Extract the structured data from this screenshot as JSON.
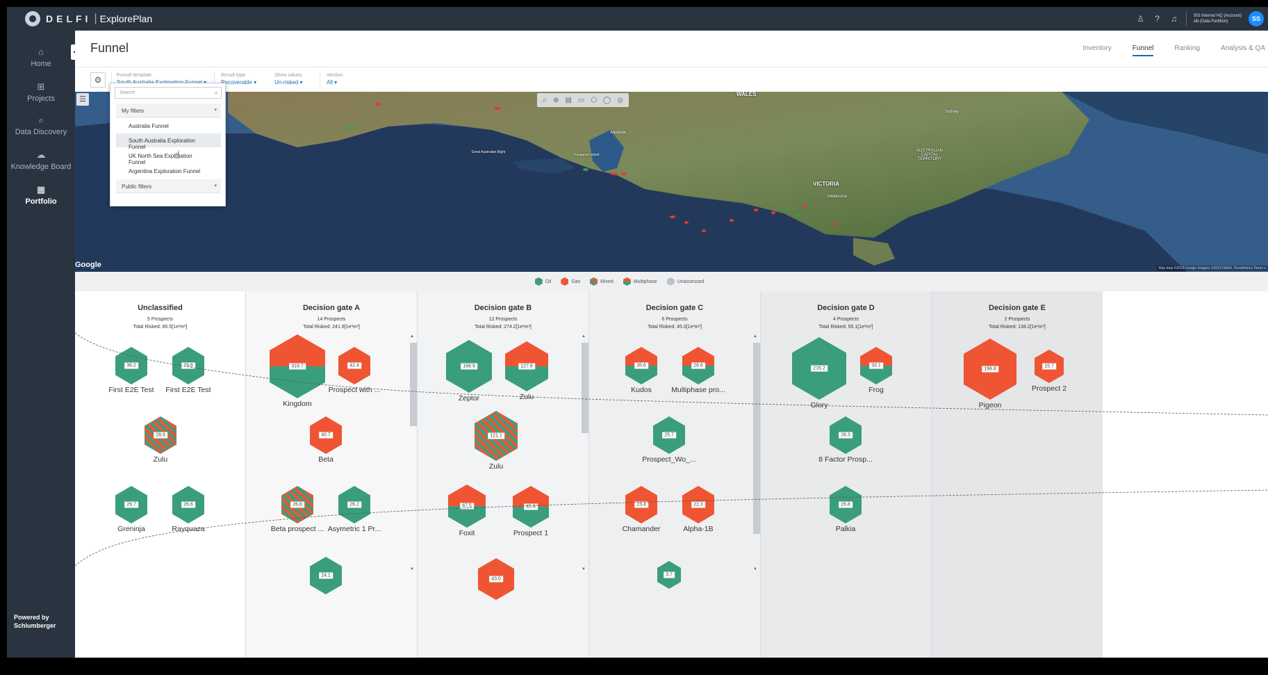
{
  "header": {
    "brand": "DELFI",
    "app_name": "ExplorePlan",
    "account_name": "SIS Internal HQ",
    "account_role": "(Account)",
    "account_sub": "slb",
    "partition": "(Data Partition)",
    "avatar_initials": "SS"
  },
  "sidebar": {
    "items": [
      {
        "label": "Home",
        "icon": "home-icon"
      },
      {
        "label": "Projects",
        "icon": "projects-icon"
      },
      {
        "label": "Data Discovery",
        "icon": "search-icon"
      },
      {
        "label": "Knowledge Board",
        "icon": "brain-icon"
      },
      {
        "label": "Portfolio",
        "icon": "calendar-grid-icon"
      }
    ],
    "powered_line1": "Powered by",
    "powered_line2": "Schlumberger"
  },
  "page": {
    "title": "Funnel",
    "tabs": [
      "Inventory",
      "Funnel",
      "Ranking",
      "Analysis & QA"
    ],
    "active_tab": "Funnel"
  },
  "filters": {
    "template_label": "Funnel template",
    "template_value": "South Australia Exploration Funnel ▾",
    "result_label": "Result type",
    "result_value": "Recoverable ▾",
    "show_label": "Show values",
    "show_value": "Un-risked ▾",
    "version_label": "Version",
    "version_value": "All ▾"
  },
  "dropdown": {
    "search_placeholder": "Search",
    "my_filters": "My filters",
    "items": [
      "Australia Funnel",
      "South Australia Exploration Funnel",
      "UK North Sea Exploration Funnel",
      "Argentina Exploration Funnel"
    ],
    "public_filters": "Public filters"
  },
  "map": {
    "google": "Google",
    "credit": "Map data ©2019 Google Imagery ©2019 NASA, TerraMetrics   Terms o",
    "labels": {
      "wales": "WALES",
      "sydney": "Sydney",
      "adelaide": "Adelaide",
      "act1": "AUSTRALIAN",
      "act2": "CAPITAL",
      "act3": "TERRITORY",
      "victoria": "VICTORIA",
      "melbourne": "Melbourne",
      "bight": "Great Australian Bight",
      "kangaroo": "Kangaroo Island"
    }
  },
  "legend": [
    {
      "label": "Oil",
      "color": "#3a9e7e"
    },
    {
      "label": "Gas",
      "color": "#ef5533"
    },
    {
      "label": "Mixed",
      "color": "#ef5533"
    },
    {
      "label": "Multiphase",
      "color": "#ef5533"
    },
    {
      "label": "Unassessed",
      "color": "#bfc3c8"
    }
  ],
  "gates": [
    {
      "title": "Unclassified",
      "count": "5 Prospects",
      "total": "Total Risked: 85.5[1e³m³]",
      "prospects": [
        {
          "name": "First E2E Test",
          "value": "36.2",
          "type": "oil"
        },
        {
          "name": "First E2E Test",
          "value": "29.6",
          "type": "oil"
        },
        {
          "name": "Zulu",
          "value": "28.9",
          "type": "mixed"
        },
        {
          "name": "Greninja",
          "value": "26.7",
          "type": "oil"
        },
        {
          "name": "Rayquaza",
          "value": "26.6",
          "type": "oil"
        }
      ]
    },
    {
      "title": "Decision gate A",
      "count": "14 Prospects",
      "total": "Total Risked: 241.9[1e³m³]",
      "prospects": [
        {
          "name": "Kingdom",
          "value": "319.7",
          "type": "multi"
        },
        {
          "name": "Prospect with ...",
          "value": "42.4",
          "type": "gas"
        },
        {
          "name": "Beta",
          "value": "40.7",
          "type": "gas"
        },
        {
          "name": "Beta prospect ...",
          "value": "26.8",
          "type": "mixed"
        },
        {
          "name": "Asymetric 1 Pr...",
          "value": "26.2",
          "type": "oil"
        },
        {
          "name": "",
          "value": "24.1",
          "type": "oil"
        }
      ]
    },
    {
      "title": "Decision gate B",
      "count": "12 Prospects",
      "total": "Total Risked: 274.2[1e³m³]",
      "prospects": [
        {
          "name": "Zeptor",
          "value": "168.9",
          "type": "oil"
        },
        {
          "name": "Zulu",
          "value": "127.8",
          "type": "multi"
        },
        {
          "name": "Zulu",
          "value": "121.1",
          "type": "mixed"
        },
        {
          "name": "Foxit",
          "value": "67.5",
          "type": "multi"
        },
        {
          "name": "Prospect 1",
          "value": "45.9",
          "type": "multi"
        },
        {
          "name": "",
          "value": "43.0",
          "type": "gas"
        }
      ]
    },
    {
      "title": "Decision gate C",
      "count": "6 Prospects",
      "total": "Total Risked: 45.0[1e³m³]",
      "prospects": [
        {
          "name": "Kudos",
          "value": "35.6",
          "type": "multi"
        },
        {
          "name": "Multiphase pro...",
          "value": "26.6",
          "type": "multi"
        },
        {
          "name": "Prospect_Wo_...",
          "value": "25.7",
          "type": "oil"
        },
        {
          "name": "Chamander",
          "value": "23.4",
          "type": "gas"
        },
        {
          "name": "Alpha-1B",
          "value": "22.3",
          "type": "gas"
        },
        {
          "name": "",
          "value": "3.7",
          "type": "oil"
        }
      ]
    },
    {
      "title": "Decision gate D",
      "count": "4 Prospects",
      "total": "Total Risked: 55.1[1e³m³]",
      "prospects": [
        {
          "name": "Glory",
          "value": "216.2",
          "type": "oil"
        },
        {
          "name": "Frog",
          "value": "33.1",
          "type": "multi"
        },
        {
          "name": "8 Factor Prosp...",
          "value": "26.3",
          "type": "oil"
        },
        {
          "name": "Palkia",
          "value": "26.8",
          "type": "oil"
        }
      ]
    },
    {
      "title": "Decision gate E",
      "count": "2 Prospects",
      "total": "Total Risked: 138.2[1e³m³]",
      "prospects": [
        {
          "name": "Pigeon",
          "value": "196.8",
          "type": "gas"
        },
        {
          "name": "Prospect 2",
          "value": "15.7",
          "type": "gas"
        }
      ]
    }
  ]
}
